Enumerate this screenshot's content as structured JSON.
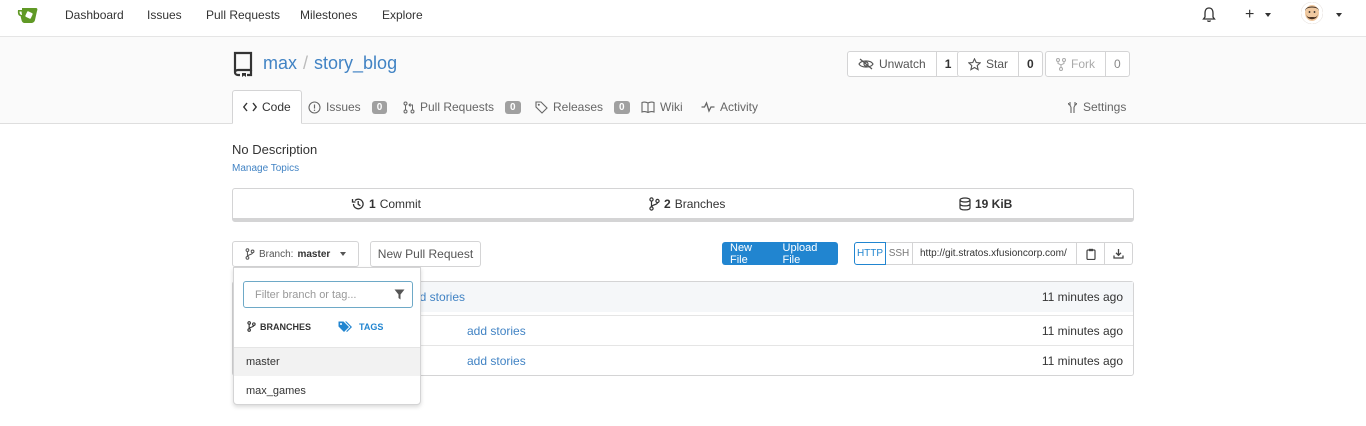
{
  "nav": {
    "items": [
      "Dashboard",
      "Issues",
      "Pull Requests",
      "Milestones",
      "Explore"
    ],
    "plus": "+"
  },
  "repo": {
    "owner": "max",
    "separator": "/",
    "name": "story_blog"
  },
  "actions": {
    "unwatch_label": "Unwatch",
    "unwatch_count": "1",
    "star_label": "Star",
    "star_count": "0",
    "fork_label": "Fork",
    "fork_count": "0"
  },
  "tabs": {
    "code": "Code",
    "issues": "Issues",
    "issues_count": "0",
    "pulls": "Pull Requests",
    "pulls_count": "0",
    "releases": "Releases",
    "releases_count": "0",
    "wiki": "Wiki",
    "activity": "Activity",
    "settings": "Settings"
  },
  "description": "No Description",
  "manage_topics": "Manage Topics",
  "stats": {
    "commits_num": "1",
    "commits_label": "Commit",
    "branches_num": "2",
    "branches_label": "Branches",
    "size": "19 KiB"
  },
  "toolbar": {
    "branch_prefix": "Branch:",
    "branch_name": "master",
    "new_pr": "New Pull Request",
    "new_file": "New File",
    "upload_file": "Upload File",
    "http": "HTTP",
    "ssh": "SSH",
    "clone_url": "http://git.stratos.xfusioncorp.com/"
  },
  "files": [
    {
      "msg": "dd stories",
      "age": "11 minutes ago"
    },
    {
      "msg": "add stories",
      "age": "11 minutes ago"
    },
    {
      "msg": "add stories",
      "age": "11 minutes ago"
    }
  ],
  "dropdown": {
    "filter_placeholder": "Filter branch or tag...",
    "branches_tab": "BRANCHES",
    "tags_tab": "TAGS",
    "items": [
      "master",
      "max_games"
    ]
  },
  "colors": {
    "link": "#4183c4",
    "primary": "#2185d0",
    "badge": "#a0a0a0",
    "logo": "#609926"
  }
}
